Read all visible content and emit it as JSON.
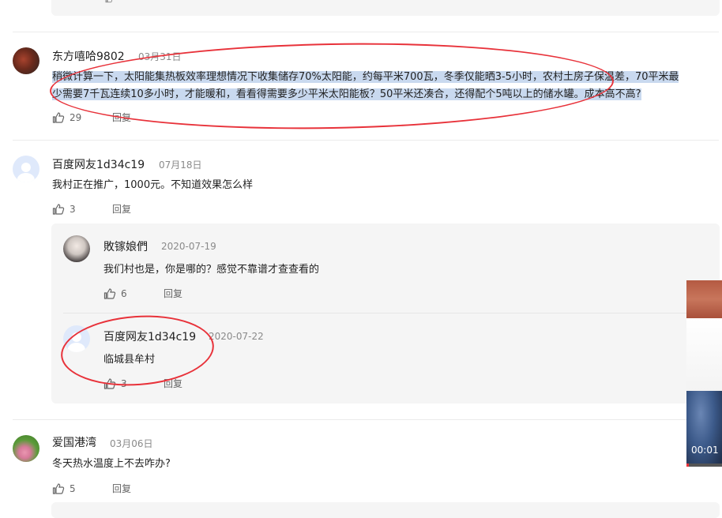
{
  "comments": [
    {
      "user": "东方嘻哈9802",
      "date": "03月31日",
      "text_line1": "稍微计算一下，太阳能集热板效率理想情况下收集储存70%太阳能，约每平米700瓦，冬季仅能晒3-5小时，农村土房子保温差，70平米最",
      "text_line2": "少需要7千瓦连续10多小时，才能暖和，看看得需要多少平米太阳能板？50平米还凑合，还得配个5吨以上的储水罐。成本高不高?",
      "likes": "29",
      "reply_label": "回复"
    },
    {
      "user": "百度网友1d34c19",
      "date": "07月18日",
      "text": "我村正在推广，1000元。不知道效果怎么样",
      "likes": "3",
      "reply_label": "回复",
      "replies": [
        {
          "user": "敗镓娘們",
          "date": "2020-07-19",
          "text": "我们村也是，你是哪的？感觉不靠谱才查查看的",
          "likes": "6",
          "reply_label": "回复"
        },
        {
          "user": "百度网友1d34c19",
          "date": "2020-07-22",
          "text": "临城县牟村",
          "likes": "3",
          "reply_label": "回复"
        }
      ]
    },
    {
      "user": "爱国港湾",
      "date": "03月06日",
      "text": "冬天热水温度上不去咋办?",
      "likes": "5",
      "reply_label": "回复"
    }
  ],
  "video": {
    "time": "00:01"
  },
  "colors": {
    "annotation": "#e8323a",
    "highlight": "#c9d9ef",
    "reply_bg": "#f5f5f5"
  }
}
